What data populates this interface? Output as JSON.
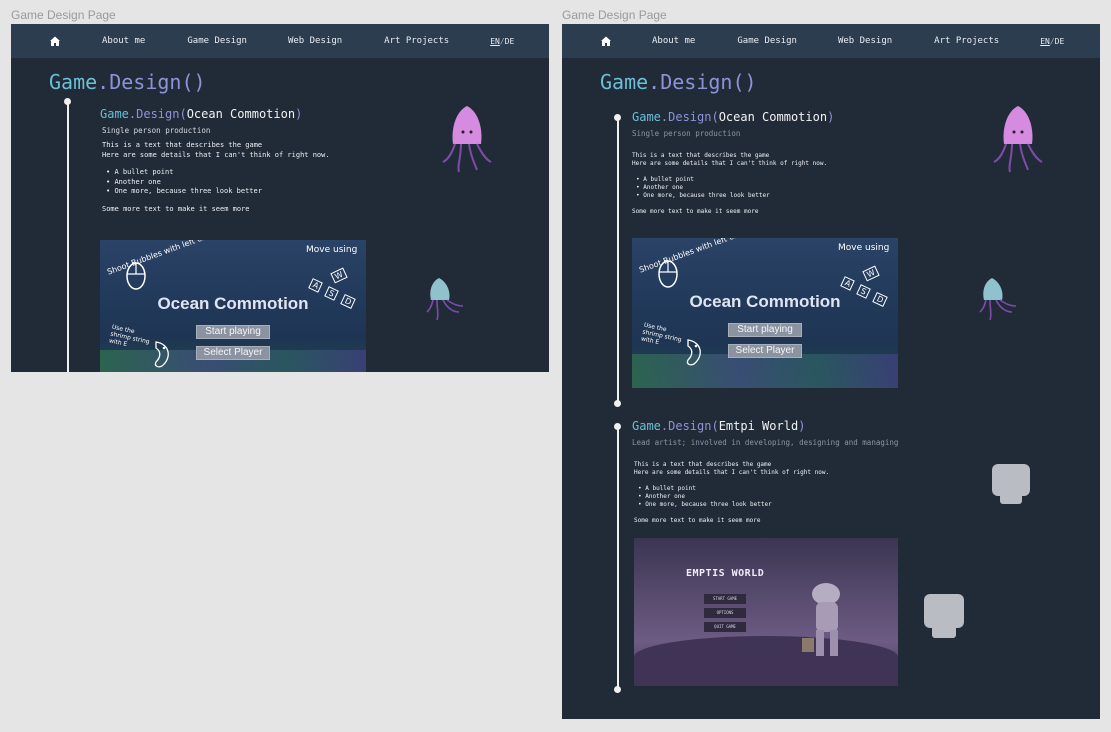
{
  "frames": [
    {
      "label": "Game Design Page",
      "nav": {
        "items": [
          "About me",
          "Game Design",
          "Web Design",
          "Art Projects"
        ],
        "lang_en": "EN",
        "lang_sep": "/",
        "lang_de": "DE"
      },
      "title": {
        "w1": "Game",
        "rest": ".Design()"
      },
      "entries": [
        {
          "title_prefix": "Game",
          "title_mid": ".Design(",
          "title_name": "Ocean Commotion",
          "title_suffix": ")",
          "subtitle": "Single person production",
          "desc_line1": "This is a text that describes the game",
          "desc_line2": "Here are some details that I can't think of right now.",
          "bullets": [
            "A bullet point",
            "Another one",
            "One more, because three look better"
          ],
          "closing": "Some more text to make it seem more",
          "game": {
            "title": "Ocean Commotion",
            "btn_start": "Start playing",
            "btn_select": "Select Player",
            "hint_shoot": "Shoot Bubbles with left click!",
            "hint_move": "Move using",
            "hint_keys": [
              "W",
              "A",
              "S",
              "D"
            ],
            "hint_shrimp": "Use the shrimp string with E"
          }
        }
      ]
    },
    {
      "label": "Game Design Page",
      "nav": {
        "items": [
          "About me",
          "Game Design",
          "Web Design",
          "Art Projects"
        ],
        "lang_en": "EN",
        "lang_sep": "/",
        "lang_de": "DE"
      },
      "title": {
        "w1": "Game",
        "rest": ".Design()"
      },
      "entries": [
        {
          "title_prefix": "Game",
          "title_mid": ".Design(",
          "title_name": "Ocean Commotion",
          "title_suffix": ")",
          "subtitle": "Single person production",
          "desc_line1": "This is a text that describes the game",
          "desc_line2": "Here are some details that I can't think of right now.",
          "bullets": [
            "A bullet point",
            "Another one",
            "One more, because three look better"
          ],
          "closing": "Some more text to make it seem more",
          "game": {
            "title": "Ocean Commotion",
            "btn_start": "Start playing",
            "btn_select": "Select Player",
            "hint_shoot": "Shoot Bubbles with left click!",
            "hint_move": "Move using",
            "hint_keys": [
              "W",
              "A",
              "S",
              "D"
            ],
            "hint_shrimp": "Use the shrimp string with E"
          }
        },
        {
          "title_prefix": "Game",
          "title_mid": ".Design(",
          "title_name": "Emtpi World",
          "title_suffix": ")",
          "subtitle": "Lead artist; involved in developing, designing and managing",
          "desc_line1": "This is a text that describes the game",
          "desc_line2": "Here are some details that I can't think of right now.",
          "bullets": [
            "A bullet point",
            "Another one",
            "One more, because three look better"
          ],
          "closing": "Some more text to make it seem more",
          "game": {
            "title": "EMPTIS WORLD",
            "menu": [
              "START GAME",
              "OPTIONS",
              "QUIT GAME"
            ]
          }
        }
      ]
    }
  ],
  "colors": {
    "page_bg": "#212b38",
    "nav_bg": "#2c3d4f",
    "accent_cyan": "#6bbfd6",
    "accent_purple": "#8e93d8",
    "squid_pink": "#d48be0",
    "squid_teal": "#8fc2cc"
  },
  "icons": [
    "home-icon",
    "squid-icon",
    "robot-head-icon"
  ]
}
